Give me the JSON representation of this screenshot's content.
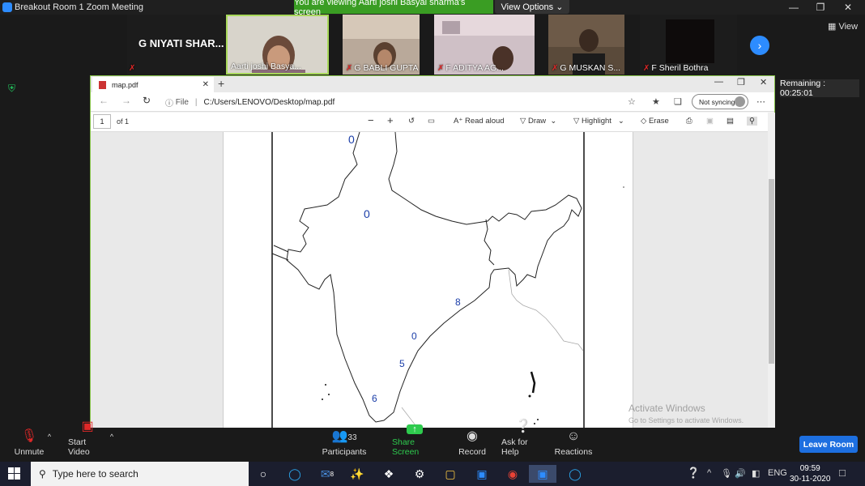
{
  "zoom": {
    "title": "Breakout Room 1  Zoom Meeting",
    "share_banner": "You are viewing Aarti joshi Basyal sharma's screen",
    "view_options": "View Options",
    "view_label": "View",
    "remaining": "Remaining : 00:25:01"
  },
  "participants": [
    {
      "name": "G NIYATI SHAR..."
    },
    {
      "name": "Aarti joshi Basya..."
    },
    {
      "name": "G BABLI GUPTA"
    },
    {
      "name": "F ADITYA AG..."
    },
    {
      "name": "G MUSKAN S..."
    },
    {
      "name": "F Sheril Bothra"
    }
  ],
  "edge": {
    "tab_title": "map.pdf",
    "file_label": "File",
    "address": "C:/Users/LENOVO/Desktop/map.pdf",
    "sync_label": "Not syncing",
    "page_number": "1",
    "page_of": "of 1",
    "read_aloud": "Read aloud",
    "draw": "Draw",
    "highlight": "Highlight",
    "erase": "Erase"
  },
  "map_marks": [
    "0",
    "0",
    "8",
    "0",
    "5",
    "6"
  ],
  "watermark": {
    "line1": "Activate Windows",
    "line2": "Go to Settings to activate Windows."
  },
  "toolbar": {
    "unmute": "Unmute",
    "start_video": "Start Video",
    "participants": "Participants",
    "participants_count": "33",
    "share_screen": "Share Screen",
    "record": "Record",
    "ask_for_help": "Ask for Help",
    "reactions": "Reactions",
    "leave_room": "Leave Room"
  },
  "taskbar": {
    "search_placeholder": "Type here to search",
    "language": "ENG",
    "time": "09:59",
    "date": "30-11-2020",
    "mail_badge": "8"
  },
  "colors": {
    "share_green": "#3a9d23",
    "zoom_blue": "#2d8cff",
    "muted_red": "#e02828"
  }
}
